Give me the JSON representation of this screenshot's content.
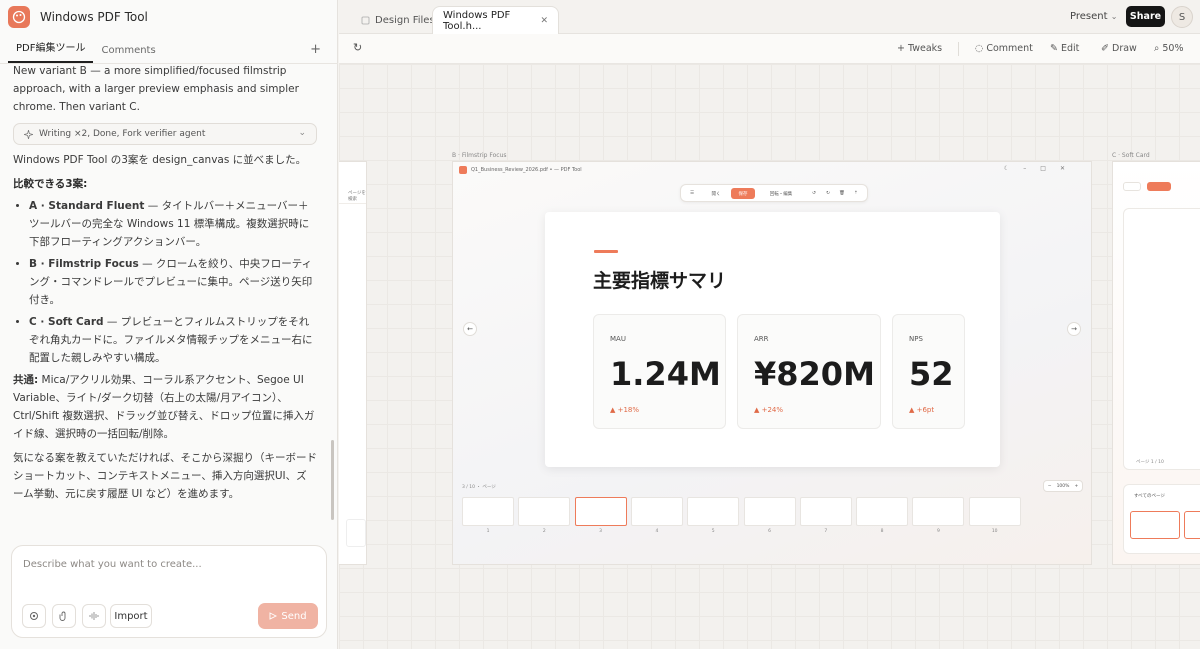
{
  "app": {
    "title": "Windows PDF Tool"
  },
  "left_tabs": [
    "PDF編集ツール",
    "Comments"
  ],
  "chat": {
    "faded_text": "New variant B — a more simplified/focused filmstrip approach, with a larger preview emphasis and simpler chrome. Then variant C.",
    "status_pill": "Writing ×2, Done, Fork verifier agent",
    "intro": "Windows PDF Tool の3案を design_canvas に並べました。",
    "heading": "比較できる3案:",
    "items": [
      {
        "name": "A · Standard Fluent",
        "desc": " — タイトルバー＋メニューバー＋ツールバーの完全な Windows 11 標準構成。複数選択時に下部フローティングアクションバー。"
      },
      {
        "name": "B · Filmstrip Focus",
        "desc": " — クロームを絞り、中央フローティング・コマンドレールでプレビューに集中。ページ送り矢印付き。"
      },
      {
        "name": "C · Soft Card",
        "desc": " — プレビューとフィルムストリップをそれぞれ角丸カードに。ファイルメタ情報チップをメニュー右に配置した親しみやすい構成。"
      }
    ],
    "common_label": "共通:",
    "common_text": " Mica/アクリル効果、コーラル系アクセント、Segoe UI Variable、ライト/ダーク切替（右上の太陽/月アイコン）、Ctrl/Shift 複数選択、ドラッグ並び替え、ドロップ位置に挿入ガイド線、選択時の一括回転/削除。",
    "closing": "気になる案を教えていただければ、そこから深掘り（キーボードショートカット、コンテキストメニュー、挿入方向選択UI、ズーム挙動、元に戻す履歴 UI など）を進めます。"
  },
  "composer": {
    "placeholder": "Describe what you want to create...",
    "import_label": "Import",
    "send_label": "Send"
  },
  "top_tabs": [
    {
      "label": "Design Files"
    },
    {
      "label": "Windows PDF Tool.h..."
    }
  ],
  "top_actions": {
    "present": "Present",
    "share": "Share",
    "avatar": "S"
  },
  "toolbar": {
    "tweaks": "Tweaks",
    "comment": "Comment",
    "edit": "Edit",
    "draw": "Draw",
    "zoom": "50%"
  },
  "canvas": {
    "frame_b_label": "B · Filmstrip Focus",
    "frame_c_label": "C · Soft Card",
    "frame_b_file": "Q1_Business_Review_2026.pdf • — PDF Tool",
    "float_tools": [
      "開く",
      "保存",
      "回転・編集"
    ],
    "slide_title": "主要指標サマリ",
    "metrics": [
      {
        "label": "MAU",
        "value": "1.24M",
        "delta": "▲ +18%"
      },
      {
        "label": "ARR",
        "value": "¥820M",
        "delta": "▲ +24%"
      },
      {
        "label": "NPS",
        "value": "52",
        "delta": "▲ +6pt"
      }
    ],
    "thumbs_label": "3 / 10 ・ ページ",
    "zoom_chip": "100%",
    "thumb_numbers": [
      "1",
      "2",
      "3",
      "4",
      "5",
      "6",
      "7",
      "8",
      "9",
      "10"
    ],
    "side_a_search": "ページを検索",
    "side_c_all_pages": "すべてのページ",
    "side_c_page": "ページ 1 / 10"
  },
  "accent_color": "#ee7b5a"
}
